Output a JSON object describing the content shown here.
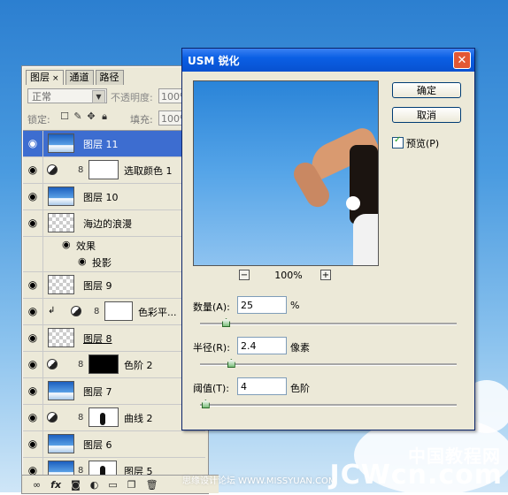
{
  "layers_panel": {
    "tabs": [
      {
        "label": "图层",
        "active": true
      },
      {
        "label": "通道",
        "active": false
      },
      {
        "label": "路径",
        "active": false
      }
    ],
    "blend_mode": "正常",
    "opacity_label": "不透明度:",
    "opacity_value": "100%",
    "lock_label": "锁定:",
    "fill_label": "填充:",
    "fill_value": "100%",
    "layers": [
      {
        "name": "图层 11",
        "thumb": "photo",
        "selected": true,
        "visible": true
      },
      {
        "name": "选取颜色 1",
        "thumb": "white",
        "adjustment": true,
        "visible": true
      },
      {
        "name": "图层 10",
        "thumb": "photo",
        "visible": true
      },
      {
        "name": "海边的浪漫",
        "thumb": "checker",
        "fx": "fx",
        "visible": true
      },
      {
        "name": "效果",
        "sub": true
      },
      {
        "name": "投影",
        "sub": true,
        "indent": true
      },
      {
        "name": "图层 9",
        "thumb": "checker",
        "visible": true
      },
      {
        "name": "色彩平...",
        "thumb": "white",
        "adjustment": true,
        "clipped": true,
        "visible": true
      },
      {
        "name": "图层 8",
        "thumb": "checker",
        "visible": true
      },
      {
        "name": "色阶 2",
        "thumb": "black",
        "adjustment": true,
        "visible": true
      },
      {
        "name": "图层 7",
        "thumb": "photo",
        "visible": true
      },
      {
        "name": "曲线 2",
        "thumb": "silhouette",
        "adjustment": true,
        "visible": true
      },
      {
        "name": "图层 6",
        "thumb": "photo",
        "visible": true
      },
      {
        "name": "图层 5",
        "thumb": "photo",
        "mask": true,
        "visible": true
      }
    ],
    "bottom_icons": [
      "link-icon",
      "fx-icon",
      "mask-icon",
      "adjustment-icon",
      "folder-icon",
      "new-layer-icon",
      "trash-icon"
    ],
    "bottom_fx_label": "fx"
  },
  "dialog": {
    "title": "USM 锐化",
    "ok_label": "确定",
    "cancel_label": "取消",
    "preview_label": "预览(P)",
    "preview_checked": true,
    "zoom_value": "100%",
    "amount": {
      "label": "数量(A):",
      "value": "25",
      "unit": "%",
      "slider_fraction": 0.1
    },
    "radius": {
      "label": "半径(R):",
      "value": "2.4",
      "unit": "像素",
      "slider_fraction": 0.12
    },
    "threshold": {
      "label": "阈值(T):",
      "value": "4",
      "unit": "色阶",
      "slider_fraction": 0.02
    }
  },
  "watermark": {
    "site_cn": "思缘设计论坛 WWW.MISSYUAN.COM",
    "brand_cn": "中国教程网",
    "brand_en": "JCWcn.com"
  }
}
